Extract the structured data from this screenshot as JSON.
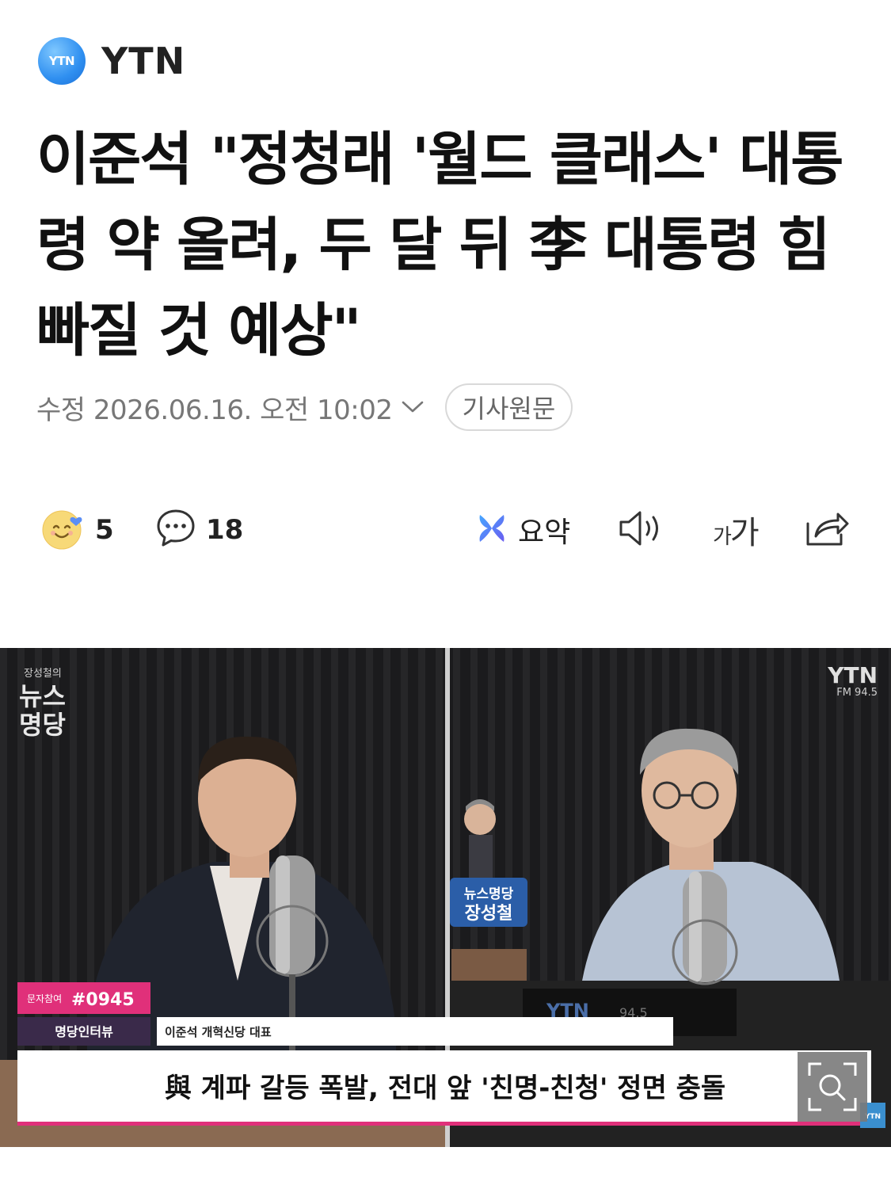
{
  "press": {
    "logo_text": "YTN",
    "name": "YTN"
  },
  "headline": "이준석 \"정청래 '월드 클래스' 대통령 약 올려, 두 달 뒤 李 대통령 힘 빠질 것 예상\"",
  "meta": {
    "date": "수정 2026.06.16. 오전 10:02",
    "original_button": "기사원문"
  },
  "actions": {
    "reaction_count": "5",
    "comment_count": "18",
    "summary_label": "요약",
    "font_size_small": "가",
    "font_size_large": "가"
  },
  "photo": {
    "show_logo_top": "장성철의",
    "show_logo_line1": "뉴스",
    "show_logo_line2": "명당",
    "broadcaster": "YTN",
    "frequency": "FM 94.5",
    "figure_sign_line1": "뉴스명당",
    "figure_sign_line2": "장성철",
    "text_tag": "문자참여",
    "text_number": "#0945",
    "segment_label": "명당인터뷰",
    "guest_caption": "이준석 개혁신당 대표",
    "headline_caption": "與 계파 갈등 폭발, 전대 앞 '친명-친청' 정면 충돌",
    "desk_logo": "YTN",
    "desk_freq": "94.5",
    "corner_logo": "YTN"
  },
  "colors": {
    "accent_pink": "#e0307a",
    "date_gray": "#777777",
    "logo_blue": "#2f8ff0"
  },
  "icons": [
    "smile-heart-icon",
    "comment-bubble-icon",
    "chevron-down-icon",
    "ai-summary-icon",
    "speaker-icon",
    "share-icon",
    "zoom-search-icon"
  ]
}
